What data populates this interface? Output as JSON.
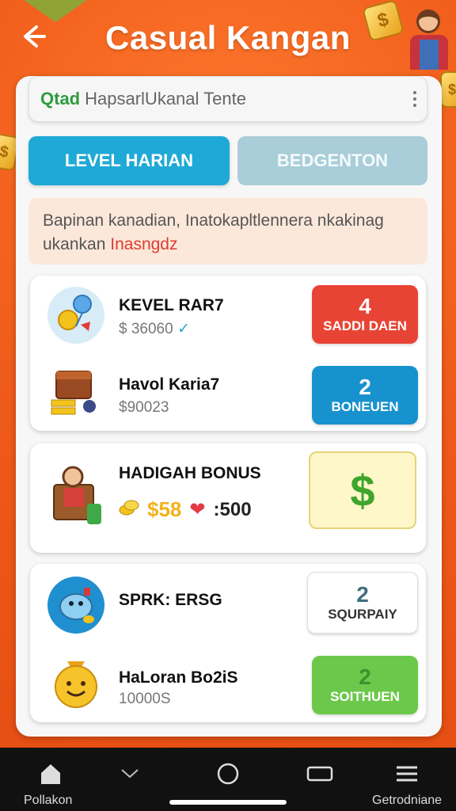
{
  "header": {
    "title": "Casual Kangan",
    "back_icon": "arrow-left-icon"
  },
  "search": {
    "brand": "Qtad",
    "placeholder": "HapsarlUkanal Tente"
  },
  "tabs": [
    {
      "label": "LEVEL HARIAN",
      "active": true
    },
    {
      "label": "BEDGENTON",
      "active": false
    }
  ],
  "notice": {
    "text": "Bapinan kanadian, Inatokapltlennera nkakinag ukankan",
    "highlight": "Inasngdz"
  },
  "cards": {
    "card1": {
      "row1": {
        "title": "KEVEL RAR7",
        "subtitle": "$ 36060",
        "check": "✓",
        "action_number": "4",
        "action_label": "SADDI DAEN",
        "icon": "coins-balloon-icon"
      },
      "row2": {
        "title": "Havol Karia7",
        "subtitle": "$90023",
        "action_number": "2",
        "action_label": "BONEUEN",
        "icon": "treasure-cart-icon"
      }
    },
    "card2": {
      "title": "HADIGAH BONUS",
      "gold_value": "$58",
      "secondary_value": ":500",
      "dollar": "$",
      "icon": "character-chair-icon"
    },
    "card3": {
      "row1": {
        "title": "SPRK: ERSG",
        "action_number": "2",
        "action_label": "SQURPAIY",
        "icon": "blue-creature-icon"
      },
      "row2": {
        "title": "HaLoran Bo2iS",
        "subtitle": "10000S",
        "action_number": "2",
        "action_label": "SOITHUEN",
        "icon": "smiley-bag-icon"
      }
    }
  },
  "navbar": {
    "left_label": "Pollakon",
    "right_label": "Getrodniane"
  },
  "colors": {
    "background": "#ee5a1c",
    "tab_active": "#1fa9d7",
    "tab_inactive": "#a9cdd9",
    "action_red": "#e84435",
    "action_blue": "#1892cf",
    "action_green": "#6cc84a"
  }
}
